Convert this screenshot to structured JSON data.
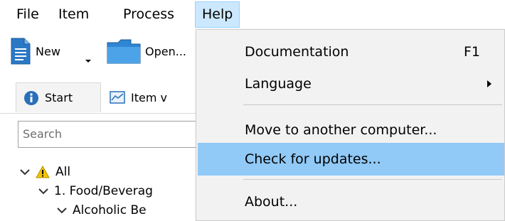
{
  "menubar": {
    "items": [
      {
        "label": "File"
      },
      {
        "label": "Item"
      },
      {
        "label": "Process"
      },
      {
        "label": "Help"
      }
    ]
  },
  "toolbar": {
    "new_label": "New",
    "open_label": "Open..."
  },
  "tabs": [
    {
      "label": "Start"
    },
    {
      "label": "Item v"
    }
  ],
  "search": {
    "placeholder": "Search"
  },
  "tree": [
    {
      "label": "All"
    },
    {
      "label": "1. Food/Beverag"
    },
    {
      "label": "Alcoholic Be"
    }
  ],
  "help_menu": {
    "documentation": {
      "label": "Documentation",
      "shortcut": "F1"
    },
    "language": {
      "label": "Language"
    },
    "move": {
      "label": "Move to another computer..."
    },
    "updates": {
      "label": "Check for updates..."
    },
    "about": {
      "label": "About..."
    }
  },
  "colors": {
    "menu_active_bg": "#cce8ff",
    "highlight_bg": "#91c9f7",
    "menu_bg": "#f2f2f2",
    "warning_icon": "#f5c400",
    "info_icon": "#2a6fb7"
  }
}
